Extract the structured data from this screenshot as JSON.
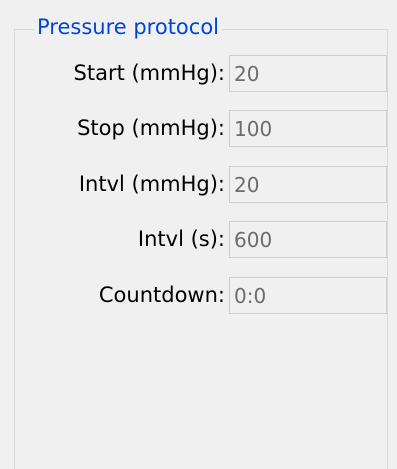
{
  "group": {
    "title": "Pressure protocol",
    "rows": [
      {
        "label": "Start (mmHg):",
        "value": "20"
      },
      {
        "label": "Stop (mmHg):",
        "value": "100"
      },
      {
        "label": "Intvl (mmHg):",
        "value": "20"
      },
      {
        "label": "Intvl (s):",
        "value": "600"
      },
      {
        "label": "Countdown:",
        "value": "0:0"
      }
    ]
  },
  "colors": {
    "title": "#0046d5",
    "background": "#f0f0f0",
    "field_border": "#cfcfcf",
    "field_text": "#6d6d6d"
  }
}
